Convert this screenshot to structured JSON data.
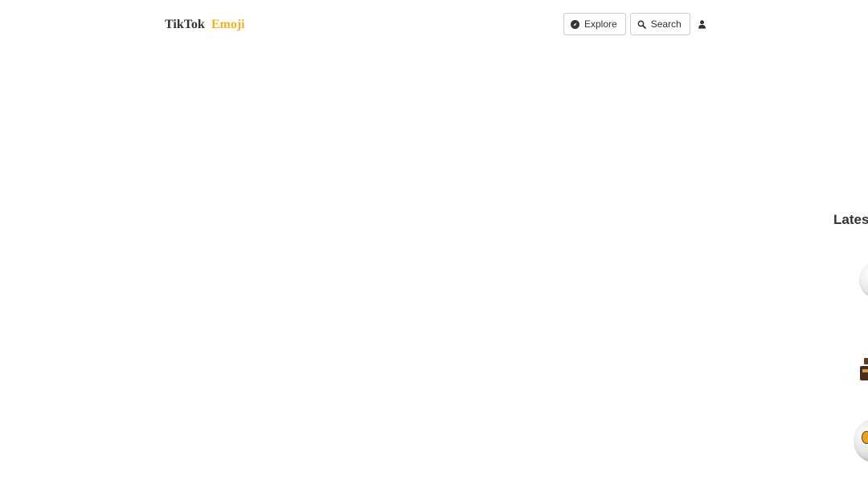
{
  "header": {
    "logo_part1": "TikTok",
    "logo_part2": "Emoji",
    "explore_label": "Explore",
    "search_label": "Search",
    "explore_icon": "compass-icon",
    "search_icon": "search-icon",
    "user_icon": "user-icon"
  },
  "colors": {
    "logo_accent": "#f5b21d",
    "text": "#333333",
    "button_border": "#cccccc"
  },
  "latest": {
    "title": "Lates"
  }
}
